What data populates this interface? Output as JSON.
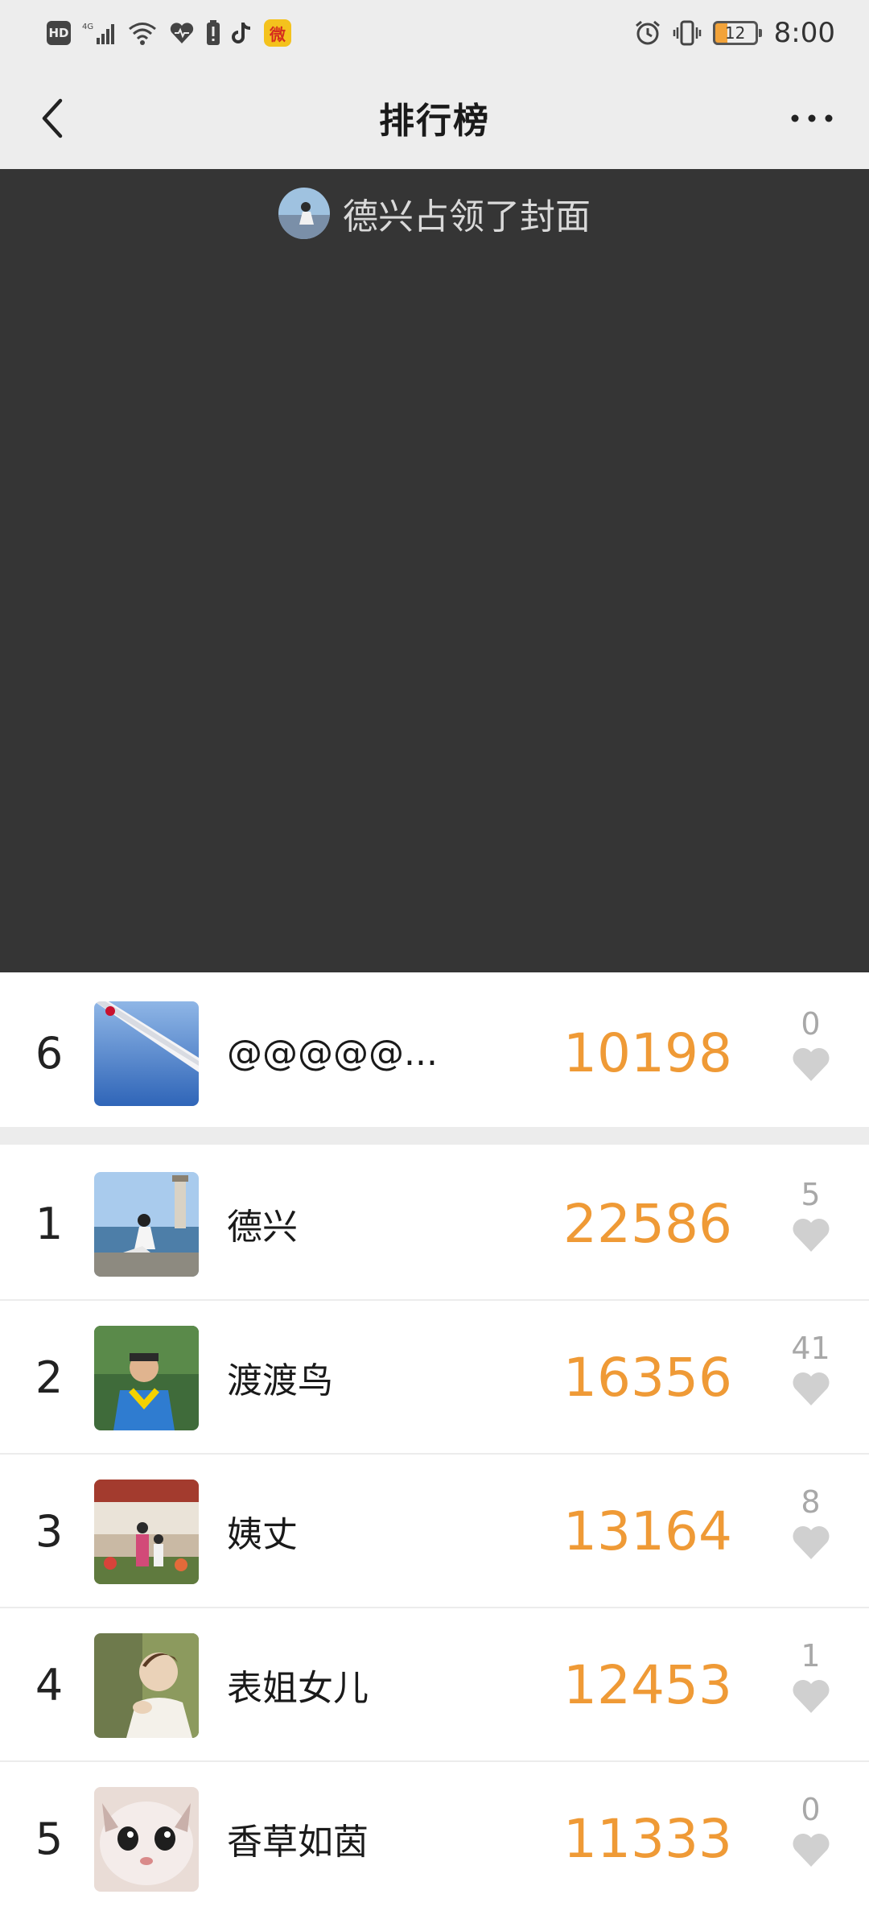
{
  "status_bar": {
    "hd": "HD",
    "network": "4G",
    "weibo": "微",
    "battery": "12",
    "time": "8:00"
  },
  "nav": {
    "title": "排行榜"
  },
  "cover": {
    "caption": "德兴占领了封面"
  },
  "my_entry": {
    "rank": "6",
    "name": "@@@@@...",
    "steps": "10198",
    "likes": "0"
  },
  "leaderboard": [
    {
      "rank": "1",
      "name": "德兴",
      "steps": "22586",
      "likes": "5"
    },
    {
      "rank": "2",
      "name": "渡渡鸟",
      "steps": "16356",
      "likes": "41"
    },
    {
      "rank": "3",
      "name": "姨丈",
      "steps": "13164",
      "likes": "8"
    },
    {
      "rank": "4",
      "name": "表姐女儿",
      "steps": "12453",
      "likes": "1"
    },
    {
      "rank": "5",
      "name": "香草如茵",
      "steps": "11333",
      "likes": "0"
    }
  ],
  "colors": {
    "steps": "#ef9a36",
    "cover_bg": "#353535",
    "header_bg": "#ededed"
  }
}
